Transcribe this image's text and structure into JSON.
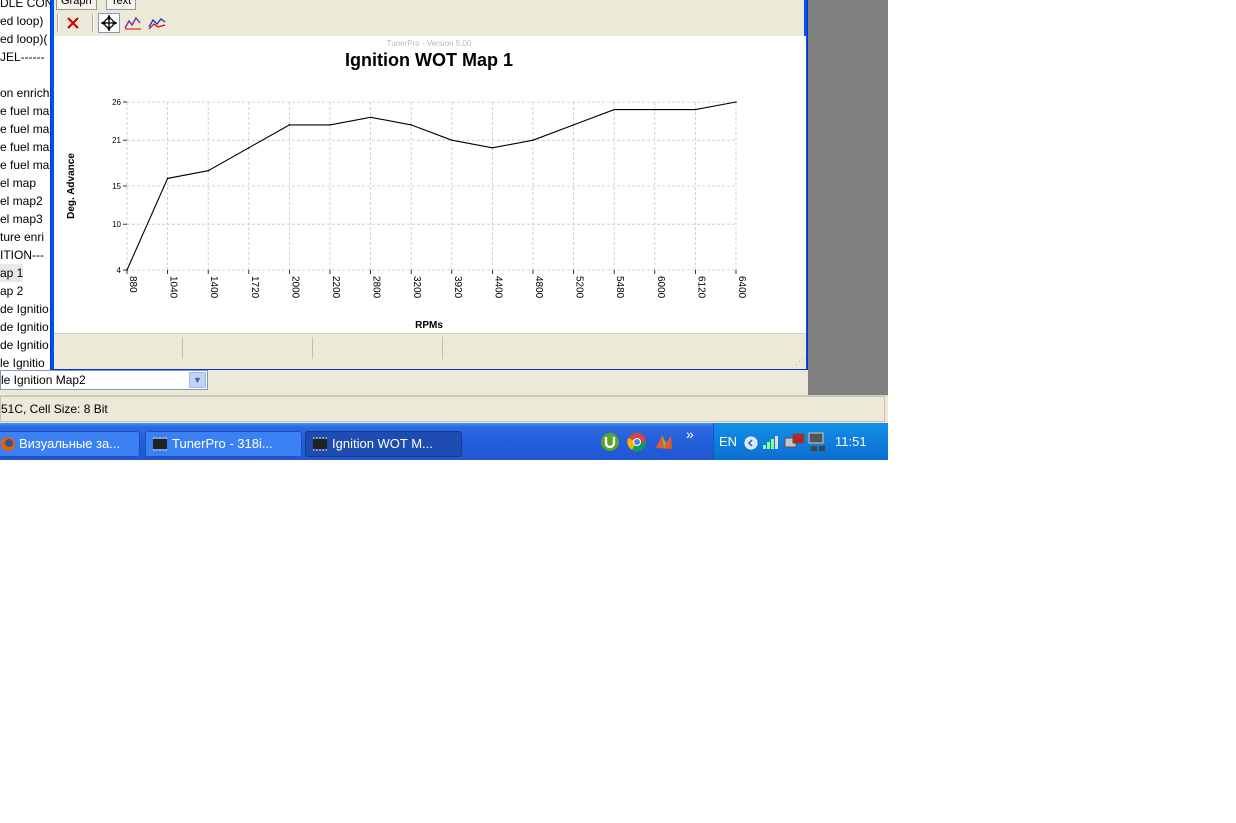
{
  "tree": {
    "items": [
      "DLE CONT",
      "ed loop)",
      "ed loop)(",
      "JEL------",
      "",
      "on enrich",
      "e fuel ma",
      "e fuel ma",
      "e fuel ma",
      "e fuel ma",
      "el map",
      "el map2",
      "el map3",
      "ture enri",
      "ITION---",
      "ap 1",
      "ap 2",
      "de Ignitio",
      "de Ignitio",
      "de Ignitio",
      "le Ignitio"
    ],
    "selected_index": 15
  },
  "combo": {
    "value": "le Ignition Map2",
    "arrow_icon": "chevron-down-icon"
  },
  "status": {
    "text": "51C,  Cell Size: 8 Bit"
  },
  "dialog": {
    "tabs": [
      "Graph",
      "Text"
    ],
    "toolbar": {
      "close_icon": "close-x-icon",
      "move_icon": "move-crosshair-icon",
      "graph_icon_1": "line-graph-icon",
      "graph_icon_2": "compare-graph-icon"
    }
  },
  "chart_data": {
    "type": "line",
    "watermark": "TunerPro - Version 5.00",
    "title": "Ignition WOT Map 1",
    "xlabel": "RPMs",
    "ylabel": "Deg. Advance",
    "x": [
      "880",
      "1040",
      "1400",
      "1720",
      "2000",
      "2200",
      "2800",
      "3200",
      "3920",
      "4400",
      "4800",
      "5200",
      "5480",
      "6000",
      "6120",
      "6400"
    ],
    "series": [
      {
        "name": "",
        "values": [
          4,
          16,
          17,
          20,
          23,
          23,
          24,
          23,
          21,
          20,
          21,
          23,
          25,
          25,
          25,
          26
        ]
      }
    ],
    "yticks": [
      4,
      10,
      15,
      21,
      26
    ],
    "ylim": [
      4,
      26
    ],
    "grid": true,
    "line_color": "#000000",
    "grid_color": "#c8c8c8"
  },
  "taskbar": {
    "buttons": [
      {
        "label": "Визуальные за...",
        "icon": "firefox-icon",
        "active": false
      },
      {
        "label": "TunerPro - 318i...",
        "icon": "chip-icon",
        "active": false
      },
      {
        "label": "Ignition WOT M...",
        "icon": "chip-icon",
        "active": true
      }
    ],
    "quick_launch": [
      "utorrent-icon",
      "chrome-icon",
      "app-icon"
    ],
    "more": "»",
    "lang": "EN",
    "clock": "11:51"
  }
}
